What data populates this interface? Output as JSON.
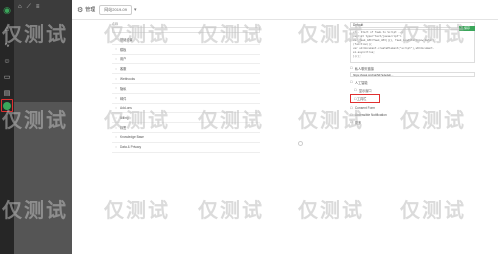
{
  "header": {
    "title": "管理",
    "breadcrumb": "网站2019-09"
  },
  "list": {
    "head": "名称",
    "search_placeholder": "",
    "items": [
      {
        "label": "基础设置"
      },
      {
        "label": "模板"
      },
      {
        "label": "用户"
      },
      {
        "label": "客服"
      },
      {
        "label": "Webhooks"
      },
      {
        "label": "隐私"
      },
      {
        "label": "邮件"
      },
      {
        "label": "Add-ons"
      },
      {
        "label": "Billing"
      },
      {
        "label": "标签"
      },
      {
        "label": "Knowledge Base"
      },
      {
        "label": "Data & Privacy"
      }
    ]
  },
  "form": {
    "section_label": "",
    "default_value": "Default",
    "save_label": "保存",
    "code_lines": [
      "<!-- Start of Tawk.to Script -->",
      "<script type=\"text/javascript\">",
      "var Tawk_API=Tawk_API||{}, Tawk_LoadStart=new Date();",
      "(function(){",
      "var s1=document.createElement(\"script\"),s0=document.",
      "s1.async=true;",
      "})();"
    ],
    "direct_link_label": "私人聊天链接",
    "direct_link_url": "https://tawk.to/chat/5d7a4e4eb...",
    "option1": "人工智能",
    "option2": "显示窗口",
    "highlight_label": "工具栏",
    "option3": "Consent Form",
    "option4": "Accessible Notification",
    "option5": "更多"
  },
  "watermark": {
    "text": "仅测试"
  }
}
